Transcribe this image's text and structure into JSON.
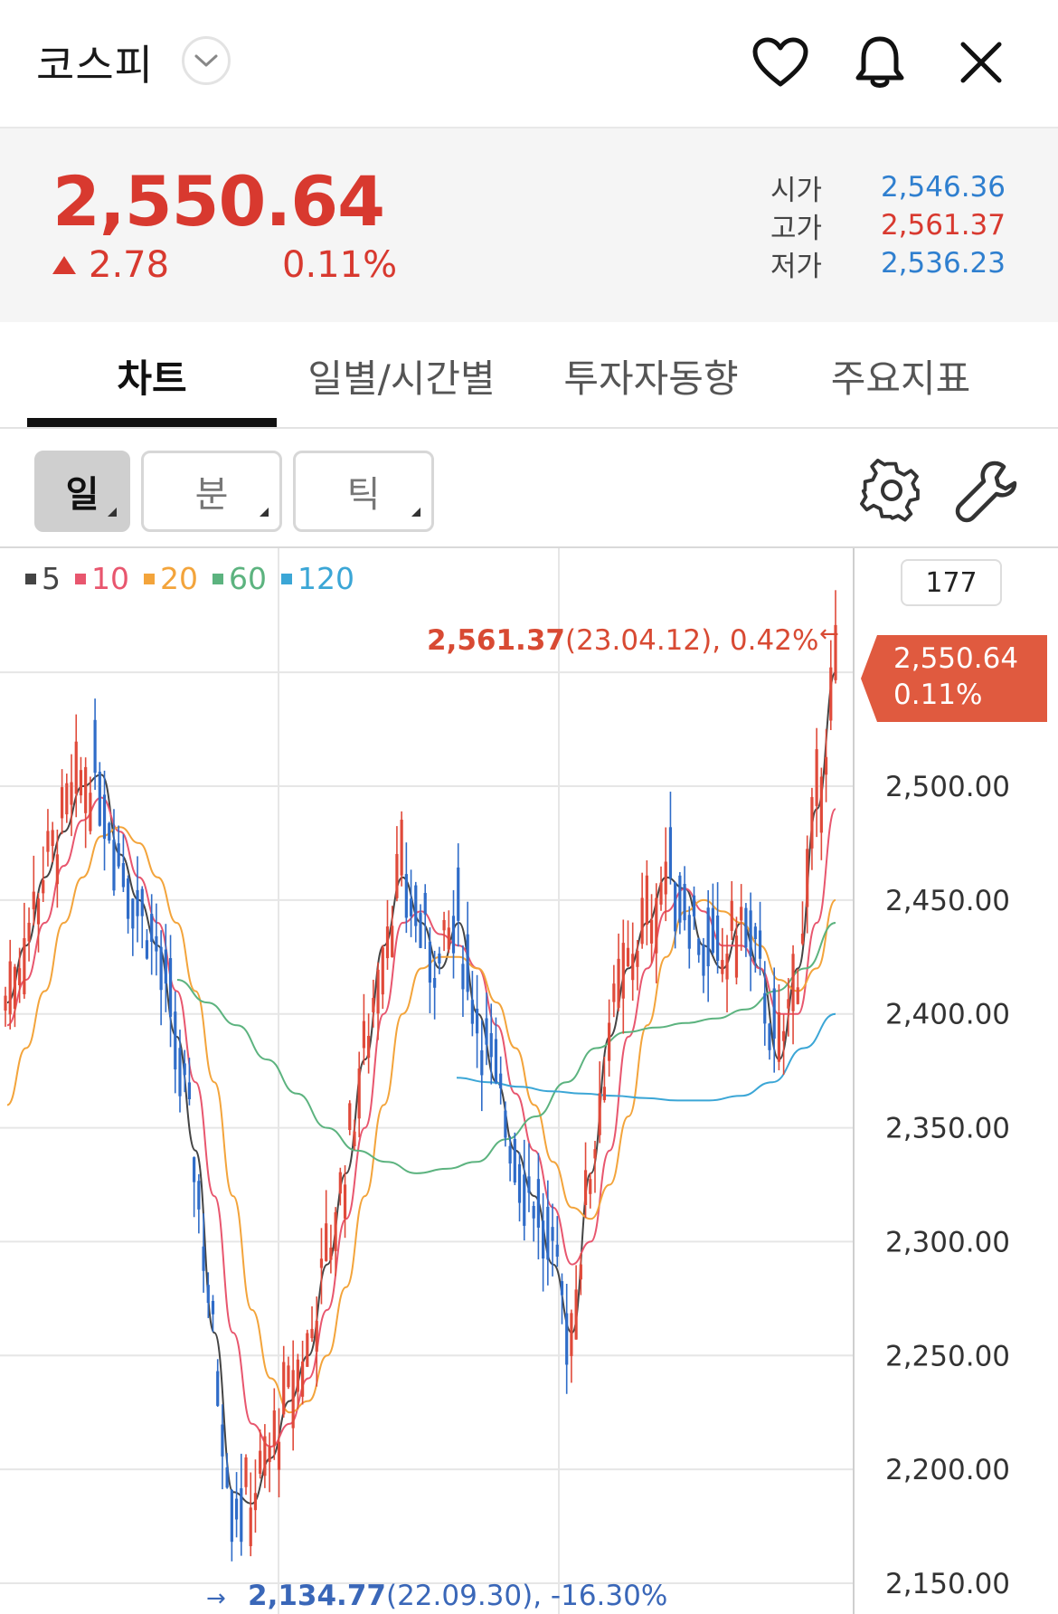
{
  "header": {
    "title": "코스피",
    "icons": [
      "chevron-down-icon",
      "heart-icon",
      "bell-icon",
      "close-icon"
    ]
  },
  "quote": {
    "price": "2,550.64",
    "change": "2.78",
    "change_pct": "0.11%",
    "ohl": [
      {
        "label": "시가",
        "value": "2,546.36",
        "color": "#2f7fcf"
      },
      {
        "label": "고가",
        "value": "2,561.37",
        "color": "#d8392f"
      },
      {
        "label": "저가",
        "value": "2,536.23",
        "color": "#2f7fcf"
      }
    ]
  },
  "tabs": [
    {
      "label": "차트",
      "active": true
    },
    {
      "label": "일별/시간별",
      "active": false
    },
    {
      "label": "투자자동향",
      "active": false
    },
    {
      "label": "주요지표",
      "active": false
    }
  ],
  "toolbar": {
    "periods": [
      {
        "label": "일",
        "active": true
      },
      {
        "label": "분",
        "active": false
      },
      {
        "label": "틱",
        "active": false
      }
    ],
    "icons": [
      "gear-icon",
      "wrench-icon"
    ]
  },
  "chart": {
    "count": "177",
    "legend": [
      {
        "label": "5",
        "color": "#444444"
      },
      {
        "label": "10",
        "color": "#e8566e"
      },
      {
        "label": "20",
        "color": "#f3a43b"
      },
      {
        "label": "60",
        "color": "#5cb37f"
      },
      {
        "label": "120",
        "color": "#3ba6d6"
      }
    ],
    "high_marker": {
      "arrow": "←",
      "value": "2,561.37",
      "detail": "(23.04.12), 0.42%",
      "color": "#d84a33"
    },
    "low_marker": {
      "arrow": "→",
      "value": "2,134.77",
      "detail": "(22.09.30), -16.30%",
      "color": "#3a67b8"
    },
    "current_tag": {
      "price": "2,550.64",
      "pct": "0.11%",
      "color": "#e05a3f"
    },
    "up_color": "#e04a3a",
    "down_color": "#2f6cc8"
  },
  "chart_data": {
    "type": "candlestick",
    "y_axis_labels": [
      "2,500.00",
      "2,450.00",
      "2,400.00",
      "2,350.00",
      "2,300.00",
      "2,250.00",
      "2,200.00",
      "2,150.00"
    ],
    "ylim": [
      2130,
      2570
    ],
    "series": [
      {
        "name": "5",
        "values": [
          2405,
          2430,
          2460,
          2480,
          2500,
          2505,
          2470,
          2450,
          2430,
          2390,
          2340,
          2260,
          2190,
          2185,
          2205,
          2230,
          2250,
          2290,
          2330,
          2380,
          2430,
          2460,
          2440,
          2420,
          2440,
          2400,
          2370,
          2340,
          2320,
          2290,
          2260,
          2330,
          2390,
          2420,
          2440,
          2460,
          2455,
          2430,
          2420,
          2440,
          2420,
          2380,
          2420,
          2490,
          2550
        ]
      },
      {
        "name": "10",
        "values": [
          2395,
          2415,
          2440,
          2465,
          2485,
          2495,
          2480,
          2460,
          2440,
          2410,
          2370,
          2320,
          2260,
          2220,
          2210,
          2220,
          2240,
          2270,
          2310,
          2350,
          2400,
          2440,
          2445,
          2435,
          2430,
          2420,
          2395,
          2365,
          2340,
          2315,
          2290,
          2300,
          2340,
          2390,
          2420,
          2445,
          2455,
          2445,
          2430,
          2430,
          2420,
          2400,
          2400,
          2440,
          2490
        ]
      },
      {
        "name": "20",
        "values": [
          2360,
          2385,
          2410,
          2440,
          2460,
          2478,
          2482,
          2475,
          2460,
          2440,
          2410,
          2370,
          2320,
          2270,
          2240,
          2225,
          2230,
          2250,
          2280,
          2320,
          2360,
          2400,
          2420,
          2425,
          2425,
          2420,
          2405,
          2385,
          2360,
          2335,
          2315,
          2310,
          2325,
          2355,
          2395,
          2425,
          2445,
          2450,
          2445,
          2440,
          2430,
          2415,
          2410,
          2420,
          2450
        ]
      },
      {
        "name": "60",
        "values": [
          2415,
          2405,
          2395,
          2380,
          2365,
          2350,
          2340,
          2335,
          2330,
          2332,
          2335,
          2345,
          2355,
          2370,
          2385,
          2392,
          2394,
          2396,
          2398,
          2402,
          2410,
          2420,
          2440
        ]
      },
      {
        "name": "120",
        "values": [
          2372,
          2370,
          2368,
          2366,
          2365,
          2364,
          2363,
          2362,
          2362,
          2364,
          2370,
          2385,
          2400
        ]
      }
    ]
  }
}
